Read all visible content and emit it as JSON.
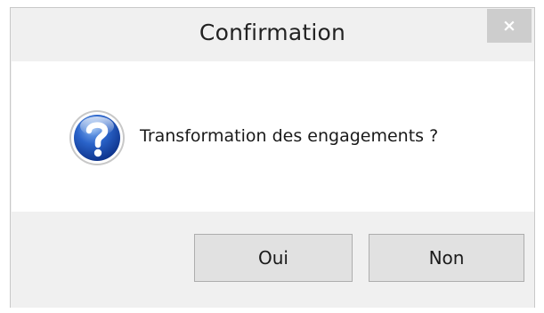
{
  "dialog": {
    "title": "Confirmation",
    "close_label": "×",
    "message": "Transformation des engagements ?",
    "icon": "question-icon",
    "buttons": {
      "yes_label": "Oui",
      "no_label": "Non"
    }
  }
}
